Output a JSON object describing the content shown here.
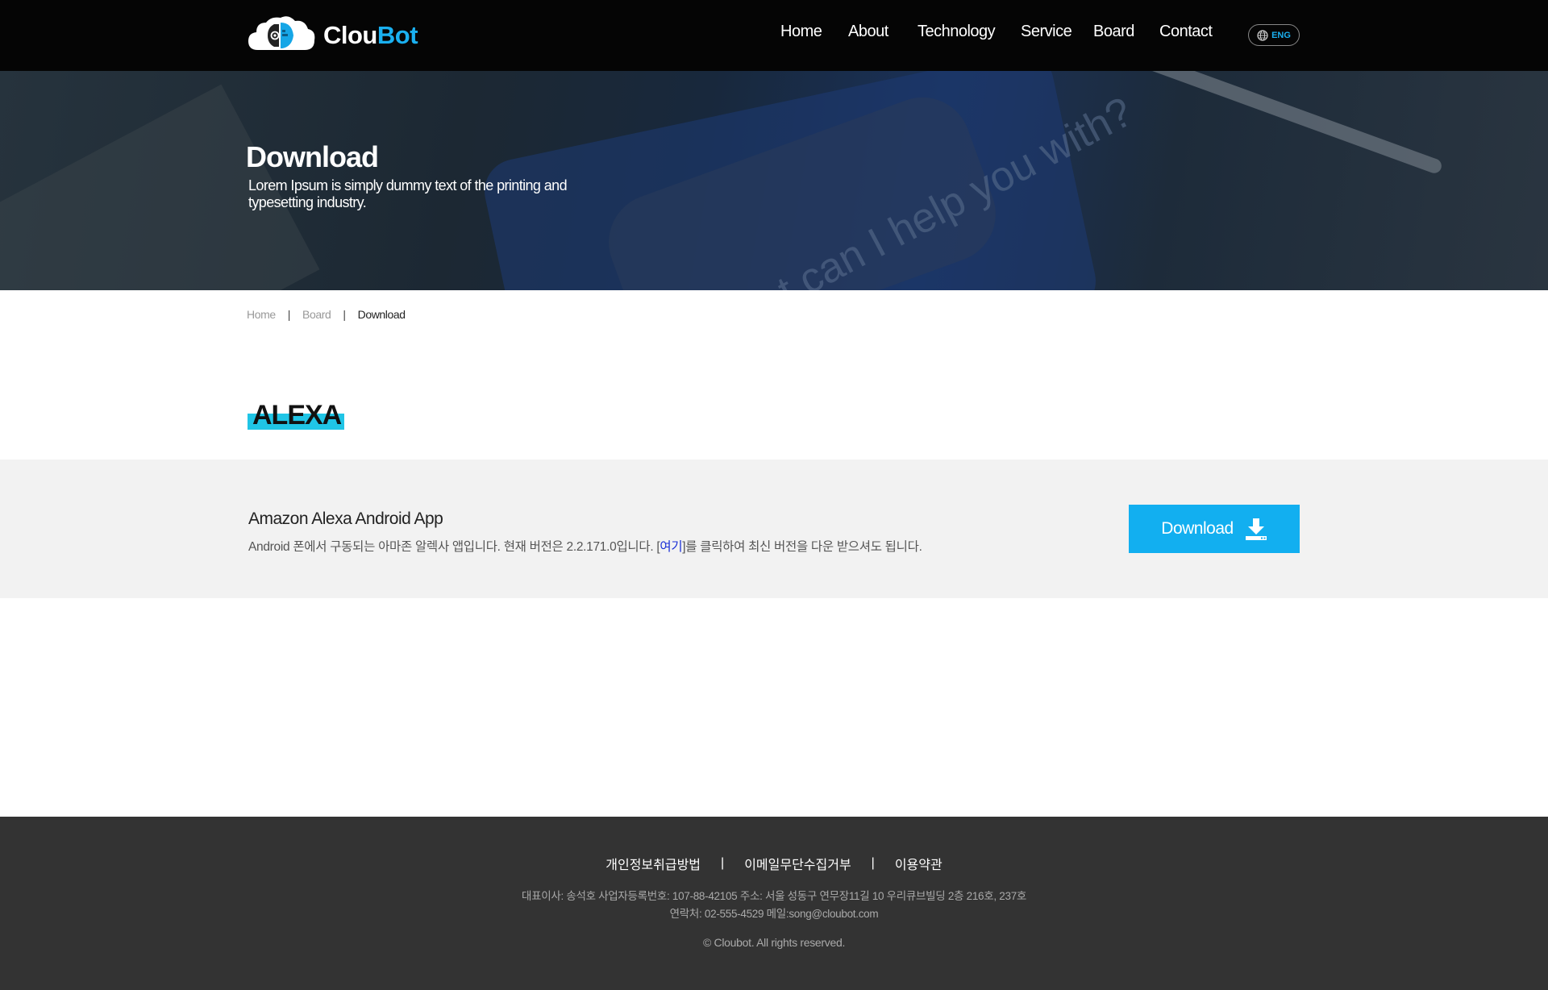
{
  "header": {
    "logo": {
      "text_part1": "Clou",
      "text_part2": "Bot",
      "icon": "cloud-robot-icon"
    },
    "nav": [
      {
        "label": "Home"
      },
      {
        "label": "About"
      },
      {
        "label": "Technology"
      },
      {
        "label": "Service"
      },
      {
        "label": "Board"
      },
      {
        "label": "Contact"
      }
    ],
    "language": {
      "label": "ENG",
      "icon": "globe-icon"
    }
  },
  "hero": {
    "title": "Download",
    "subtitle": "Lorem Ipsum is simply dummy text of the printing and typesetting industry.",
    "background_text": "What can I help you with?"
  },
  "breadcrumb": {
    "items": [
      "Home",
      "Board"
    ],
    "current": "Download",
    "separator": "|"
  },
  "section": {
    "title": "ALEXA"
  },
  "download_item": {
    "name": "Amazon Alexa Android App",
    "desc_before": "Android 폰에서 구동되는 아마존 알렉사 앱입니다. 현재 버전은 2.2.171.0입니다. [",
    "desc_link": "여기",
    "desc_after": "]를 클릭하여 최신 버전을 다운 받으셔도 됩니다.",
    "button_label": "Download",
    "button_icon": "download-icon"
  },
  "footer": {
    "links": [
      "개인정보취급방법",
      "이메일무단수집거부",
      "이용약관"
    ],
    "separator": "|",
    "info_line1": "대표이사: 송석호  사업자등록번호: 107-88-42105  주소: 서울 성동구 연무장11길 10 우리큐브빌딩 2층 216호, 237호",
    "info_line2": "연락처: 02-555-4529  메일:song@cloubot.com",
    "copyright": "© Cloubot. All rights reserved."
  },
  "colors": {
    "accent": "#12aff0",
    "highlight": "#20c5e6",
    "header_bg": "#050505",
    "footer_bg": "#333333",
    "panel_bg": "#f2f2f2"
  }
}
